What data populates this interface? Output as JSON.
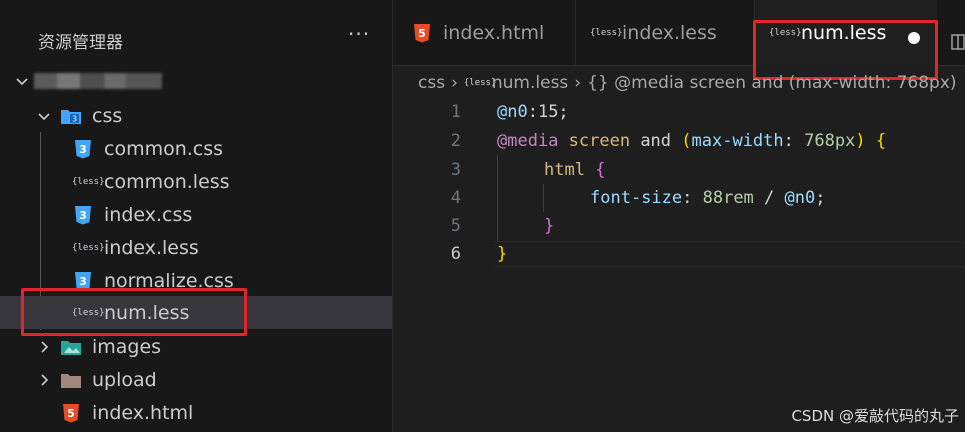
{
  "sidebar": {
    "title": "资源管理器",
    "more": "···",
    "items": [
      {
        "label": "",
        "type": "root"
      },
      {
        "label": "css",
        "type": "folder"
      },
      {
        "label": "common.css",
        "type": "css"
      },
      {
        "label": "common.less",
        "type": "less"
      },
      {
        "label": "index.css",
        "type": "css"
      },
      {
        "label": "index.less",
        "type": "less"
      },
      {
        "label": "normalize.css",
        "type": "css"
      },
      {
        "label": "num.less",
        "type": "less"
      },
      {
        "label": "images",
        "type": "folder"
      },
      {
        "label": "upload",
        "type": "folder"
      },
      {
        "label": "index.html",
        "type": "html"
      }
    ]
  },
  "tabs": [
    {
      "label": "index.html",
      "type": "html"
    },
    {
      "label": "index.less",
      "type": "less"
    },
    {
      "label": "num.less",
      "type": "less",
      "active": true
    }
  ],
  "icons": {
    "less": "{less}"
  },
  "breadcrumb": {
    "folder": "css",
    "file": "num.less",
    "symbol": "{} @media screen and (max-width: 768px)"
  },
  "editor": {
    "line_numbers": [
      "1",
      "2",
      "3",
      "4",
      "5",
      "6"
    ],
    "lines": [
      [
        "@n0",
        ":15;"
      ],
      [
        "@media",
        " screen",
        " and ",
        "(",
        "max-width",
        ": ",
        "768px",
        ")",
        " ",
        "{"
      ],
      [
        "html",
        " ",
        "{"
      ],
      [
        "font-size",
        ": ",
        "88rem",
        " / ",
        "@n0",
        ";"
      ],
      [
        "}"
      ],
      [
        "}"
      ]
    ]
  },
  "watermark": "CSDN @爱敲代码的丸子",
  "colors": {
    "highlight_box": "#e0262b",
    "css_icon": "#42a5f5",
    "html_icon": "#e44d26"
  }
}
